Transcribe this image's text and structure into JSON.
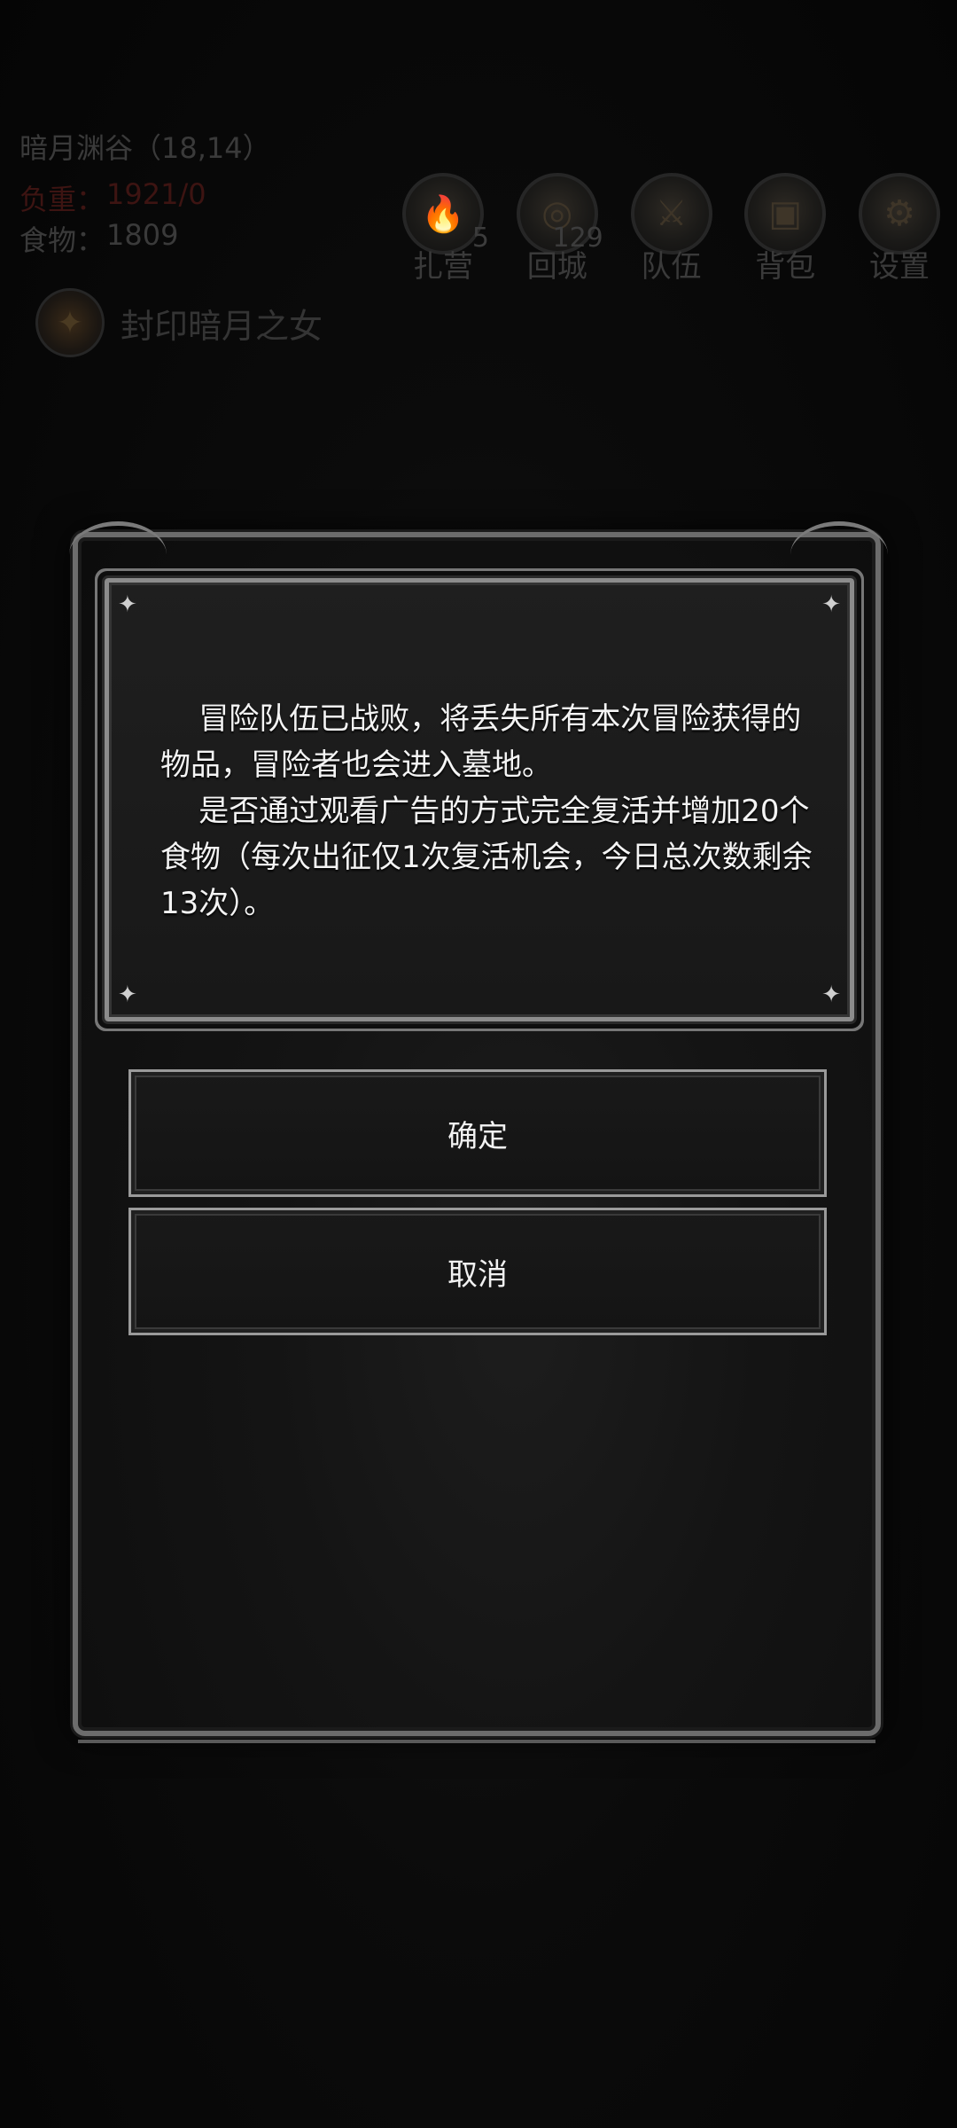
{
  "hud": {
    "location": "暗月渊谷（18,14）",
    "load_label": "负重：",
    "load_value": "1921/0",
    "food_label": "食物：",
    "food_value": "1809",
    "buttons": [
      {
        "label": "扎营",
        "badge": "5",
        "icon": "campfire-icon"
      },
      {
        "label": "回城",
        "badge": "129",
        "icon": "portal-icon"
      },
      {
        "label": "队伍",
        "badge": "",
        "icon": "team-icon"
      },
      {
        "label": "背包",
        "badge": "",
        "icon": "chest-icon"
      },
      {
        "label": "设置",
        "badge": "",
        "icon": "gear-icon"
      }
    ],
    "quest_label": "封印暗月之女"
  },
  "dialog": {
    "message": "    冒险队伍已战败，将丢失所有本次冒险获得的物品，冒险者也会进入墓地。\n    是否通过观看广告的方式完全复活并增加20个食物（每次出征仅1次复活机会，今日总次数剩余13次）。",
    "confirm_label": "确定",
    "cancel_label": "取消"
  }
}
